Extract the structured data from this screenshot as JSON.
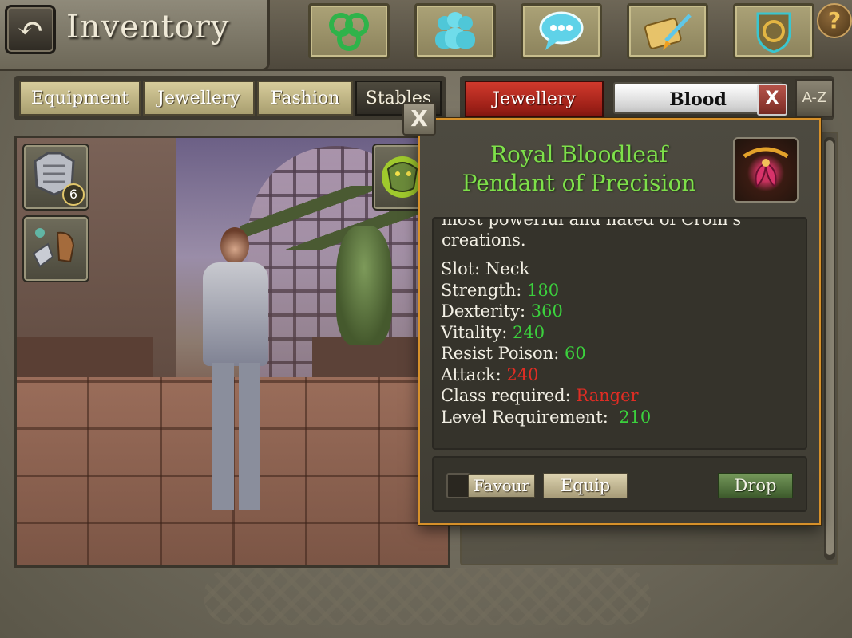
{
  "header": {
    "title": "Inventory",
    "help_label": "?",
    "icons": [
      "triskele-icon",
      "players-icon",
      "chat-icon",
      "quest-scroll-icon",
      "guild-crest-icon"
    ]
  },
  "left_tabs": {
    "items": [
      "Equipment",
      "Jewellery",
      "Fashion",
      "Stables"
    ],
    "active": "Stables"
  },
  "right_tabs": {
    "category": "Jewellery",
    "search_value": "Blood",
    "clear_label": "X",
    "sort_label": "A-Z"
  },
  "equipment_slots": [
    {
      "icon": "armor-chest-icon",
      "count": "6"
    },
    {
      "icon": "gauntlets-icon"
    },
    {
      "icon": "dragon-pet-icon"
    }
  ],
  "popup": {
    "close_label": "X",
    "item_name_line1": "Royal Bloodleaf",
    "item_name_line2": "Pendant of Precision",
    "item_icon": "bloodleaf-pendant-icon",
    "description_partial": "most powerful and hated of Crom's",
    "description_line2": "creations.",
    "slot_label": "Slot: Neck",
    "stats": [
      {
        "label": "Strength: ",
        "value": "180",
        "color": "#3bd13d"
      },
      {
        "label": "Dexterity: ",
        "value": "360",
        "color": "#3bd13d"
      },
      {
        "label": "Vitality: ",
        "value": "240",
        "color": "#3bd13d"
      },
      {
        "label": "Resist Poison: ",
        "value": "60",
        "color": "#3bd13d"
      },
      {
        "label": "Attack: ",
        "value": "240",
        "color": "#e02d24"
      },
      {
        "label": "Class required: ",
        "value": "Ranger",
        "color": "#e02d24"
      },
      {
        "label": "Level Requirement:  ",
        "value": "210",
        "color": "#3bd13d"
      }
    ],
    "favour_label": "Favour",
    "equip_label": "Equip",
    "drop_label": "Drop"
  },
  "colors": {
    "item_name": "#7ee04a",
    "popup_border": "#d6902a",
    "active_category": "#d0392c"
  }
}
